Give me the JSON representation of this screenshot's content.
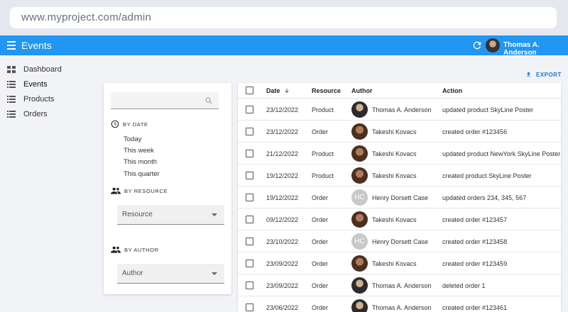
{
  "browser": {
    "url": "www.myproject.com/admin"
  },
  "appbar": {
    "title": "Events",
    "user_name": "Thomas A. Anderson",
    "accent": "#2196f3"
  },
  "sidebar": {
    "items": [
      {
        "label": "Dashboard",
        "icon": "dashboard-icon"
      },
      {
        "label": "Events",
        "icon": "list-icon"
      },
      {
        "label": "Products",
        "icon": "list-icon"
      },
      {
        "label": "Orders",
        "icon": "list-icon"
      }
    ],
    "active": "Events"
  },
  "toolbar": {
    "export_label": "EXPORT"
  },
  "filters": {
    "search_placeholder": "",
    "by_date": {
      "label": "BY DATE",
      "options": [
        "Today",
        "This week",
        "This month",
        "This quarter"
      ]
    },
    "by_resource": {
      "label": "BY RESOURCE",
      "select_value": "Resource"
    },
    "by_author": {
      "label": "BY AUTHOR",
      "select_value": "Author"
    }
  },
  "table": {
    "headers": {
      "date": "Date",
      "resource": "Resource",
      "author": "Author",
      "action": "Action"
    },
    "rows": [
      {
        "date": "23/12/2022",
        "resource": "Product",
        "author": "Thomas A. Anderson",
        "avatar": "photo-a",
        "action": "updated product SkyLine Poster"
      },
      {
        "date": "23/12/2022",
        "resource": "Order",
        "author": "Takeshi Kovacs",
        "avatar": "photo-b",
        "action": "created order #123456"
      },
      {
        "date": "21/12/2022",
        "resource": "Product",
        "author": "Takeshi Kovacs",
        "avatar": "photo-b",
        "action": "updated product NewYork SkyLine Poster"
      },
      {
        "date": "19/12/2022",
        "resource": "Product",
        "author": "Takeshi Kovacs",
        "avatar": "photo-b",
        "action": "created product SkyLine Poster"
      },
      {
        "date": "19/12/2022",
        "resource": "Order",
        "author": "Henry Dorsett Case",
        "avatar": "HC",
        "action": "updated orders 234, 345, 567"
      },
      {
        "date": "09/12/2022",
        "resource": "Order",
        "author": "Takeshi Kovacs",
        "avatar": "photo-b",
        "action": "created order #123457"
      },
      {
        "date": "23/10/2022",
        "resource": "Order",
        "author": "Henry Dorsett Case",
        "avatar": "HC",
        "action": "created order #123458"
      },
      {
        "date": "23/09/2022",
        "resource": "Order",
        "author": "Takeshi Kovacs",
        "avatar": "photo-b",
        "action": "created order #123459"
      },
      {
        "date": "23/09/2022",
        "resource": "Order",
        "author": "Thomas A. Anderson",
        "avatar": "photo-a",
        "action": "deleted order 1"
      },
      {
        "date": "23/06/2022",
        "resource": "Order",
        "author": "Thomas A. Anderson",
        "avatar": "photo-a",
        "action": "created order #123461"
      }
    ]
  }
}
